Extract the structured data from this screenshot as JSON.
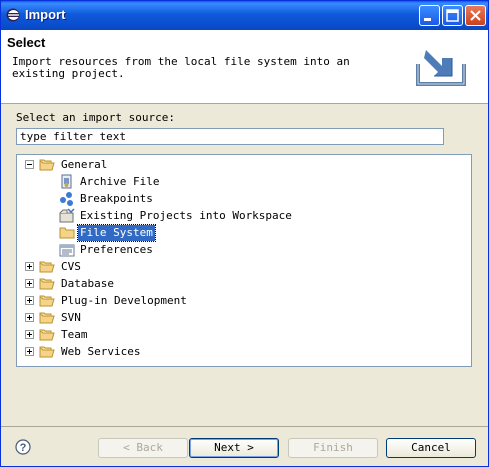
{
  "window": {
    "title": "Import"
  },
  "header": {
    "title": "Select",
    "description": "Import resources from the local file system into an existing project."
  },
  "source": {
    "label": "Select an import source:"
  },
  "filter": {
    "value": "type filter text"
  },
  "tree": {
    "general": {
      "label": "General",
      "children": {
        "archive": "Archive File",
        "breakpoints": "Breakpoints",
        "existing": "Existing Projects into Workspace",
        "filesystem": "File System",
        "preferences": "Preferences"
      }
    },
    "cvs": "CVS",
    "database": "Database",
    "plugin": "Plug-in Development",
    "svn": "SVN",
    "team": "Team",
    "webservices": "Web Services"
  },
  "buttons": {
    "back": "< Back",
    "next": "Next >",
    "finish": "Finish",
    "cancel": "Cancel"
  }
}
